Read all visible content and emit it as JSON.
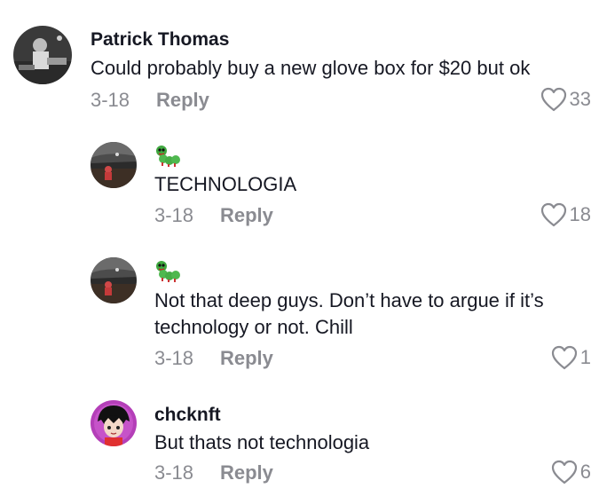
{
  "comments": [
    {
      "author": "Patrick Thomas",
      "text": "Could probably buy a new glove box for $20 but ok",
      "date": "3-18",
      "reply_label": "Reply",
      "likes": "33",
      "avatar_icon": "dj-photo-avatar"
    },
    {
      "author": "",
      "author_icon": "caterpillar-emoji",
      "text": "TECHNOLOGIA",
      "date": "3-18",
      "reply_label": "Reply",
      "likes": "18",
      "avatar_icon": "night-photo-avatar"
    },
    {
      "author": "",
      "author_icon": "caterpillar-emoji",
      "text": "Not that deep guys. Don’t have to argue if it’s technology or not. Chill",
      "date": "3-18",
      "reply_label": "Reply",
      "likes": "1",
      "avatar_icon": "night-photo-avatar"
    },
    {
      "author": "chcknft",
      "text": "But thats not technologia",
      "date": "3-18",
      "reply_label": "Reply",
      "likes": "6",
      "avatar_icon": "anime-character-avatar"
    }
  ],
  "colors": {
    "text": "#161823",
    "muted": "#8a8b91",
    "background": "#ffffff"
  }
}
